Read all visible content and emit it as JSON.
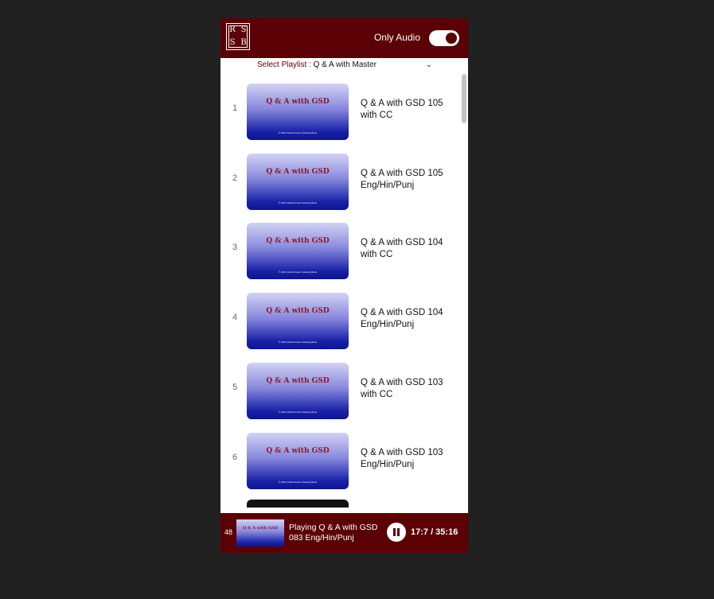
{
  "header": {
    "logo_top": "RS",
    "logo_bottom": "SB",
    "logo_letters": [
      "R",
      "S",
      "S",
      "B"
    ],
    "only_audio_label": "Only Audio",
    "only_audio_on": true
  },
  "playlist_select": {
    "label": "Select Playlist :",
    "value": "Q & A with Master"
  },
  "thumbnail": {
    "title": "Q & A with GSD",
    "copyright": "© 2021 Radha Soami Satsang Beas"
  },
  "items": [
    {
      "num": "1",
      "title": "Q & A with GSD 105 with CC"
    },
    {
      "num": "2",
      "title": "Q & A with GSD 105 Eng/Hin/Punj"
    },
    {
      "num": "3",
      "title": "Q & A with GSD 104 with CC"
    },
    {
      "num": "4",
      "title": "Q & A with GSD 104 Eng/Hin/Punj"
    },
    {
      "num": "5",
      "title": "Q & A with GSD 103 with CC"
    },
    {
      "num": "6",
      "title": "Q & A with GSD 103 Eng/Hin/Punj"
    }
  ],
  "player": {
    "num": "48",
    "thumb_title": "Q & A with GSD",
    "text": "Playing Q & A with GSD 083 Eng/Hin/Punj",
    "time": "17:7 / 35:16"
  },
  "colors": {
    "brand": "#5b0004",
    "background": "#212121",
    "thumb_top": "#d2d2f4",
    "thumb_bottom": "#0c158f"
  },
  "icons": [
    "logo-icon",
    "toggle-switch",
    "chevron-down-icon",
    "pause-icon"
  ]
}
